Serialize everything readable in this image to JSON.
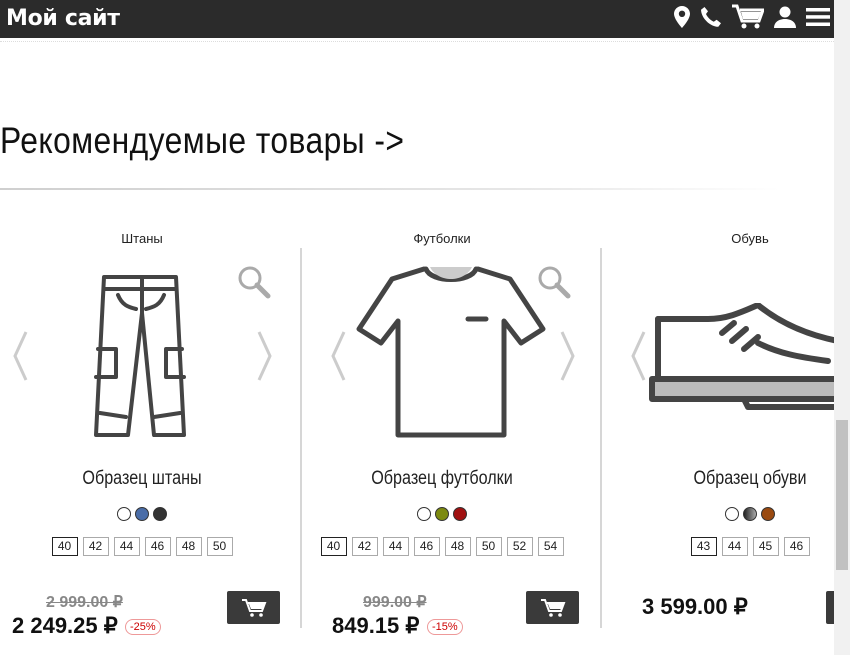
{
  "header": {
    "site_title": "Мой сайт",
    "icons": [
      "location-icon",
      "phone-icon",
      "cart-icon",
      "user-icon",
      "menu-icon"
    ]
  },
  "section": {
    "title": "Рекомендуемые товары ->"
  },
  "products": [
    {
      "category": "Штаны",
      "name": "Образец штаны",
      "swatches": [
        "#ffffff",
        "#4a6da8",
        "#333333"
      ],
      "sizes": [
        "40",
        "42",
        "44",
        "46",
        "48",
        "50"
      ],
      "selected_size": "40",
      "old_price": "2 999.00 ₽",
      "price": "2 249.25 ₽",
      "discount": "-25%"
    },
    {
      "category": "Футболки",
      "name": "Образец футболки",
      "swatches": [
        "#ffffff",
        "#7c8a10",
        "#a01010"
      ],
      "sizes": [
        "40",
        "42",
        "44",
        "46",
        "48",
        "50",
        "52",
        "54"
      ],
      "selected_size": "40",
      "old_price": "999.00 ₽",
      "price": "849.15 ₽",
      "discount": "-15%"
    },
    {
      "category": "Обувь",
      "name": "Образец обуви",
      "swatches": [
        "#ffffff",
        "#555555",
        "#9a4a10"
      ],
      "sizes": [
        "43",
        "44",
        "45",
        "46"
      ],
      "selected_size": "43",
      "old_price": "",
      "price": "3 599.00 ₽",
      "discount": ""
    }
  ]
}
